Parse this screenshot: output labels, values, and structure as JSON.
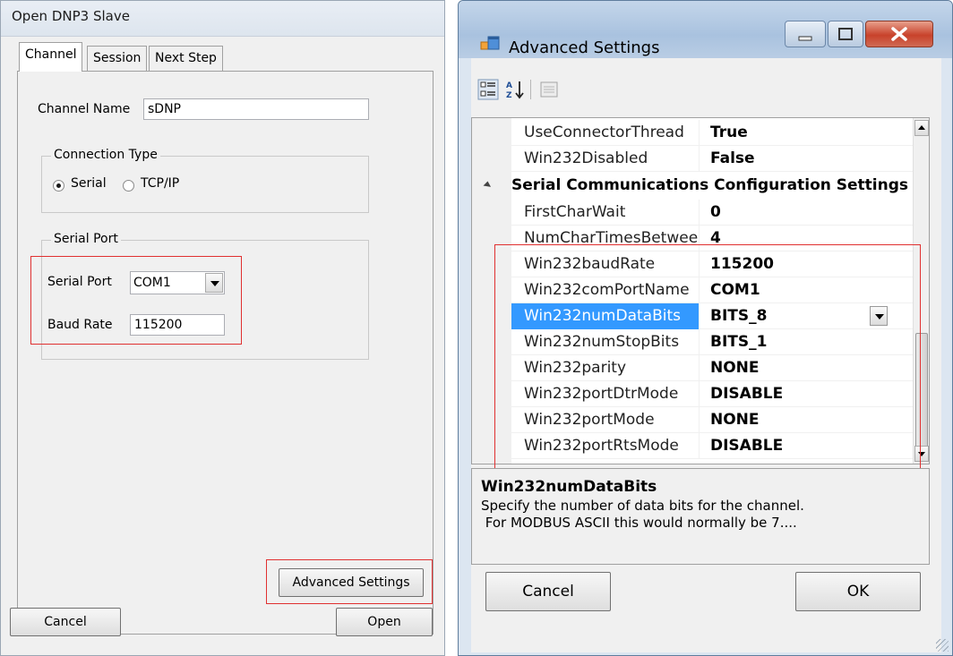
{
  "left_dialog": {
    "title": "Open DNP3 Slave",
    "tabs": [
      "Channel",
      "Session",
      "Next Step"
    ],
    "channel_name_label": "Channel Name",
    "channel_name_value": "sDNP",
    "connection_type": {
      "title": "Connection Type",
      "options": [
        "Serial",
        "TCP/IP"
      ],
      "selected": "Serial"
    },
    "serial_port_group": {
      "title": "Serial Port",
      "port_label": "Serial Port",
      "port_value": "COM1",
      "baud_label": "Baud Rate",
      "baud_value": "115200"
    },
    "buttons": {
      "advanced": "Advanced Settings",
      "cancel": "Cancel",
      "open": "Open"
    },
    "highlight_color": "#e03030"
  },
  "right_dialog": {
    "title": "Advanced Settings",
    "rows_before": [
      {
        "name": "UseConnectorThread",
        "value": "True"
      },
      {
        "name": "Win232Disabled",
        "value": "False"
      }
    ],
    "category": "Serial Communications Configuration Settings",
    "rows_after": [
      {
        "name": "FirstCharWait",
        "value": "0"
      },
      {
        "name": "NumCharTimesBetwee",
        "value": "4"
      },
      {
        "name": "Win232baudRate",
        "value": "115200"
      },
      {
        "name": "Win232comPortName",
        "value": "COM1"
      },
      {
        "name": "Win232numDataBits",
        "value": "BITS_8"
      },
      {
        "name": "Win232numStopBits",
        "value": "BITS_1"
      },
      {
        "name": "Win232parity",
        "value": "NONE"
      },
      {
        "name": "Win232portDtrMode",
        "value": "DISABLE"
      },
      {
        "name": "Win232portMode",
        "value": "NONE"
      },
      {
        "name": "Win232portRtsMode",
        "value": "DISABLE"
      }
    ],
    "help": {
      "title": "Win232numDataBits",
      "text": "Specify the number of data bits for the channel.\n For MODBUS ASCII this would normally be 7...."
    },
    "buttons": {
      "cancel": "Cancel",
      "ok": "OK"
    },
    "selection_color": "#3399ff"
  }
}
